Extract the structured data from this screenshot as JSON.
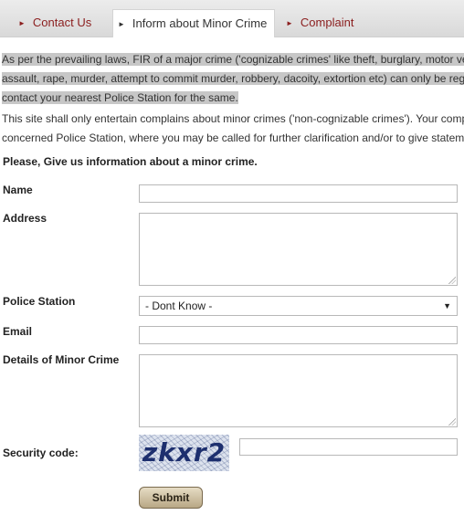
{
  "tabs": [
    {
      "label": "Contact Us"
    },
    {
      "label": "Inform about Minor Crime"
    },
    {
      "label": "Complaint"
    }
  ],
  "info": {
    "line1": "As per the prevailing laws, FIR of a major crime ('cognizable crimes' like theft, burglary, motor vehicle theft,",
    "line2": "assault, rape, murder, attempt to commit murder, robbery, dacoity, extortion etc) can only be registered at a police station.",
    "line3": "contact your nearest Police Station for the same.",
    "line4": "This site shall only entertain complains about minor crimes ('non-cognizable crimes'). Your complaint will be forwarded to the",
    "line5": "concerned Police Station, where you may be called for further clarification and/or to give statement."
  },
  "form": {
    "heading": "Please, Give us information about a minor crime.",
    "name_label": "Name",
    "address_label": "Address",
    "station_label": "Police Station",
    "station_value": "- Dont Know -",
    "email_label": "Email",
    "details_label": "Details of Minor Crime",
    "security_label": "Security code:",
    "captcha_text": "zkxr2",
    "submit_label": "Submit"
  }
}
